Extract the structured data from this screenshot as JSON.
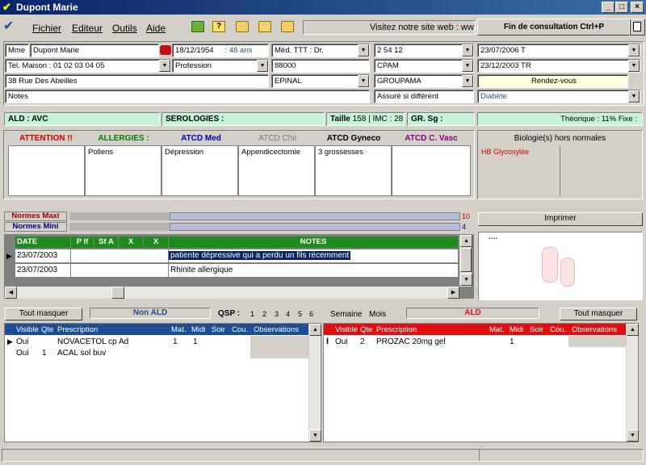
{
  "window": {
    "title": "Dupont Marie"
  },
  "menu": {
    "items": [
      "Fichier",
      "Editeur",
      "Outils",
      "Aide"
    ]
  },
  "toolbar": {
    "site_text": "Visitez notre site web : ww",
    "end_button": "Fin de consultation    Ctrl+P"
  },
  "patient": {
    "civility": "Mme",
    "name": "Dupont Marie",
    "birth": "18/12/1954",
    "age": ": 48 ans",
    "phone": "Tel. Maison : 01 02 03 04 05",
    "profession": "Profession",
    "street": "38 Rue Des Abeilles",
    "notes": "Notes",
    "med": "Méd. TTT : Dr.",
    "postal": "88000",
    "city": "EPINAL",
    "secu": "2 54 12",
    "caisse": "CPAM",
    "mutuelle": "GROUPAMA",
    "assure": "Assuré si différent",
    "date1": "23/07/2006  T",
    "date2": "23/12/2003  TR",
    "rdv": "Rendez-vous",
    "pathology": "Diabète"
  },
  "info": {
    "ald": "ALD :  AVC",
    "sero": "SEROLOGIES :",
    "taille_label": "Taille",
    "taille": "158",
    "imc_label": "IMC :",
    "imc": "28",
    "gr": "GR. Sg :",
    "theorique": "Théorique : 11%  Fixe :"
  },
  "antecedents": {
    "headers": [
      "ATTENTION !!",
      "ALLERGIES :",
      "ATCD Med",
      "ATCD Chir",
      "ATCD Gyneco",
      "ATCD C. Vasc"
    ],
    "colors": [
      "#d00000",
      "#008000",
      "#0000c0",
      "#808080",
      "#000000",
      "#800080"
    ],
    "values": [
      "",
      "Pollens",
      "Dépression",
      "Appendicectomie",
      "3 grossesses",
      ""
    ]
  },
  "biologie": {
    "title": "Biologie(s) hors normales",
    "item": "HB Glycosylée"
  },
  "normes": {
    "maxi": "Normes Maxi",
    "mini": "Normes Mini",
    "maxi_val": "10",
    "mini_val": "4"
  },
  "notes_grid": {
    "headers": [
      "DATE",
      "P If",
      "Sf A",
      "X",
      "X",
      "NOTES"
    ],
    "rows": [
      {
        "date": "23/07/2003",
        "note": "patiente dépressive qui a perdu un fils récemment"
      },
      {
        "date": "23/07/2003",
        "note": "Rhinite allergique"
      }
    ]
  },
  "imprimer": {
    "label": "Imprimer",
    "dots": "....",
    "accent": "#f7c8c8"
  },
  "presc_bar": {
    "tout_masquer": "Tout masquer",
    "non_ald": "Non ALD",
    "qsp": "QSP :",
    "qsp_nums": [
      "1",
      "2",
      "3",
      "4",
      "5",
      "6"
    ],
    "semaine": "Semaine",
    "mois": "Mois",
    "ald": "ALD",
    "tout_masquer2": "Tout masquer"
  },
  "left_grid": {
    "headers": [
      "Visible",
      "Qte",
      "Prescription",
      "Mat.",
      "Midi",
      "Soir",
      "Cou.",
      "Observations"
    ],
    "header_color": "#1c4e96",
    "rows": [
      {
        "visible": "Oui",
        "qte": "",
        "presc": "NOVACETOL  cp Ad",
        "mat": "1",
        "midi": "1"
      },
      {
        "visible": "Oui",
        "qte": "1",
        "presc": "ACAL  sol buv",
        "mat": "",
        "midi": ""
      }
    ]
  },
  "right_grid": {
    "headers": [
      "Visible",
      "Qte",
      "Prescription",
      "Mat.",
      "Midi",
      "Soir",
      "Cou.",
      "Observations"
    ],
    "header_color": "#e01010",
    "rows": [
      {
        "visible": "Oui",
        "qte": "2",
        "presc": "PROZAC 20mg gel",
        "mat": "",
        "midi": "1"
      }
    ]
  }
}
